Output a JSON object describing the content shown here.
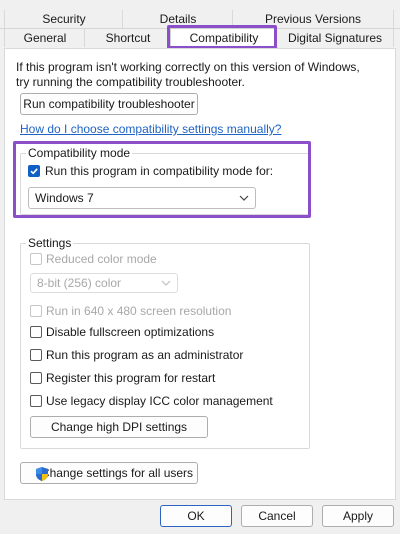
{
  "tabs": {
    "row1": [
      "Security",
      "Details",
      "Previous Versions"
    ],
    "row2": [
      "General",
      "Shortcut",
      "Compatibility",
      "Digital Signatures"
    ],
    "active": "Compatibility"
  },
  "intro": {
    "text": "If this program isn't working correctly on this version of Windows, try running the compatibility troubleshooter."
  },
  "run_troubleshooter_label": "Run compatibility troubleshooter",
  "how_to_link": "How do I choose compatibility settings manually?",
  "compat_mode": {
    "title": "Compatibility mode",
    "checkbox_label": "Run this program in compatibility mode for:",
    "checked": true,
    "selected": "Windows 7"
  },
  "settings": {
    "title": "Settings",
    "reduced_color": "Reduced color mode",
    "color_select": "8-bit (256) color",
    "run_640": "Run in 640 x 480 screen resolution",
    "disable_fullscreen": "Disable fullscreen optimizations",
    "run_admin": "Run this program as an administrator",
    "register_restart": "Register this program for restart",
    "legacy_icc": "Use legacy display ICC color management",
    "high_dpi_button": "Change high DPI settings"
  },
  "change_all_users": "Change settings for all users",
  "footer": {
    "ok": "OK",
    "cancel": "Cancel",
    "apply": "Apply"
  },
  "colors": {
    "accent": "#0f5fc4",
    "highlight": "#8a4fc9",
    "link": "#1f63c4"
  },
  "icons": {
    "shield": "uac-shield-icon",
    "chevron": "chevron-down-icon",
    "check": "checkmark-icon"
  }
}
